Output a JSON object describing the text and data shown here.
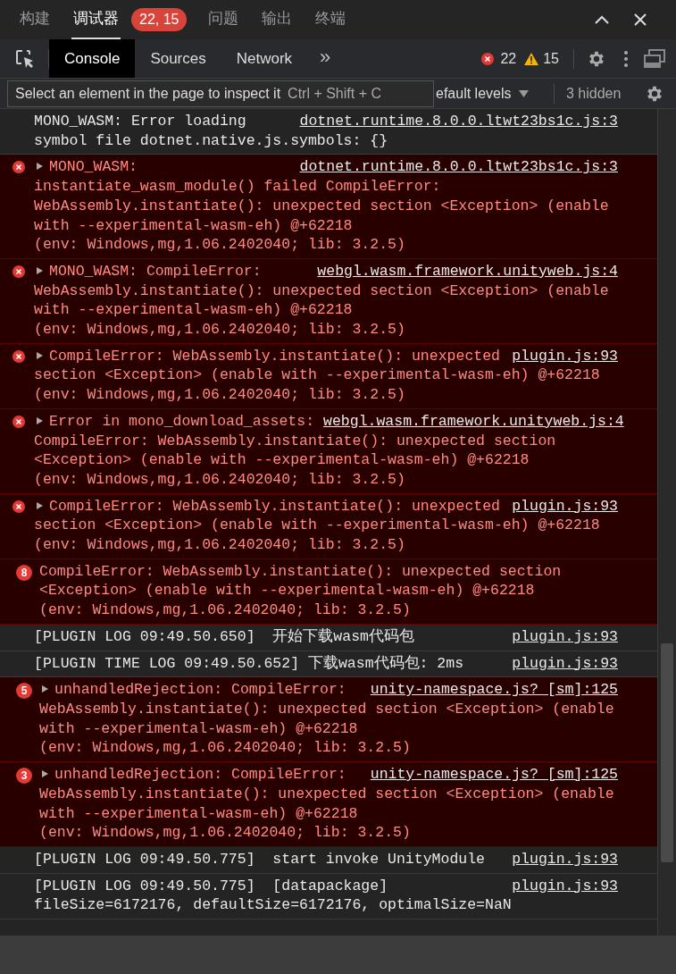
{
  "panel_tabs": [
    {
      "label": "构建",
      "selected": false
    },
    {
      "label": "调试器",
      "selected": true,
      "badge": "22, 15"
    },
    {
      "label": "问题",
      "selected": false
    },
    {
      "label": "输出",
      "selected": false
    },
    {
      "label": "终端",
      "selected": false
    }
  ],
  "devtools_tabs": [
    {
      "label": "Console",
      "selected": true
    },
    {
      "label": "Sources",
      "selected": false
    },
    {
      "label": "Network",
      "selected": false
    }
  ],
  "more_tabs": "»",
  "error_count": "22",
  "warning_count": "15",
  "tooltip": {
    "text": "Select an element in the page to inspect it",
    "shortcut": "Ctrl + Shift + C"
  },
  "filter_bar": {
    "levels": "efault levels",
    "hidden": "3 hidden"
  },
  "entries": [
    {
      "kind": "log",
      "lines": [
        "MONO_WASM: Error loading",
        "symbol file dotnet.native.js.symbols: {}"
      ],
      "source": "dotnet.runtime.8.0.0.ltwt23bs1c.js:3"
    },
    {
      "kind": "error",
      "expandable": true,
      "lines": [
        "MONO_WASM:",
        "instantiate_wasm_module() failed CompileError:",
        "WebAssembly.instantiate(): unexpected section <Exception> (enable",
        "with --experimental-wasm-eh) @+62218",
        "(env: Windows,mg,1.06.2402040; lib: 3.2.5)"
      ],
      "source": "dotnet.runtime.8.0.0.ltwt23bs1c.js:3"
    },
    {
      "kind": "error",
      "expandable": true,
      "lines": [
        "MONO_WASM: CompileError:",
        "WebAssembly.instantiate(): unexpected section <Exception> (enable",
        "with --experimental-wasm-eh) @+62218",
        "(env: Windows,mg,1.06.2402040; lib: 3.2.5)"
      ],
      "source": "webgl.wasm.framework.unityweb.js:4"
    },
    {
      "kind": "error",
      "expandable": true,
      "lines": [
        "CompileError: WebAssembly.instantiate(): unexpected",
        "section <Exception> (enable with --experimental-wasm-eh) @+62218",
        "(env: Windows,mg,1.06.2402040; lib: 3.2.5)"
      ],
      "source": "plugin.js:93"
    },
    {
      "kind": "error",
      "expandable": true,
      "lines": [
        "Error in mono_download_assets:",
        "CompileError: WebAssembly.instantiate(): unexpected section",
        "<Exception> (enable with --experimental-wasm-eh) @+62218",
        "(env: Windows,mg,1.06.2402040; lib: 3.2.5)"
      ],
      "source": "webgl.wasm.framework.unityweb.js:4"
    },
    {
      "kind": "error",
      "expandable": true,
      "lines": [
        "CompileError: WebAssembly.instantiate(): unexpected",
        "section <Exception> (enable with --experimental-wasm-eh) @+62218",
        "(env: Windows,mg,1.06.2402040; lib: 3.2.5)"
      ],
      "source": "plugin.js:93"
    },
    {
      "kind": "error",
      "expandable": false,
      "count": "8",
      "lines": [
        "CompileError: WebAssembly.instantiate(): unexpected section",
        "<Exception> (enable with --experimental-wasm-eh) @+62218",
        "(env: Windows,mg,1.06.2402040; lib: 3.2.5)"
      ]
    },
    {
      "kind": "log",
      "lines": [
        "[PLUGIN LOG 09:49.50.650]  开始下载wasm代码包"
      ],
      "source": "plugin.js:93"
    },
    {
      "kind": "log",
      "lines": [
        "[PLUGIN TIME LOG 09:49.50.652] 下载wasm代码包: 2ms"
      ],
      "source": "plugin.js:93"
    },
    {
      "kind": "error",
      "expandable": true,
      "count": "5",
      "lines": [
        "unhandledRejection: CompileError:",
        "WebAssembly.instantiate(): unexpected section <Exception> (enable",
        "with --experimental-wasm-eh) @+62218",
        "(env: Windows,mg,1.06.2402040; lib: 3.2.5)"
      ],
      "source": "unity-namespace.js? [sm]:125"
    },
    {
      "kind": "error",
      "expandable": true,
      "count": "3",
      "lines": [
        "unhandledRejection: CompileError:",
        "WebAssembly.instantiate(): unexpected section <Exception> (enable",
        "with --experimental-wasm-eh) @+62218",
        "(env: Windows,mg,1.06.2402040; lib: 3.2.5)"
      ],
      "source": "unity-namespace.js? [sm]:125"
    },
    {
      "kind": "log",
      "lines": [
        "[PLUGIN LOG 09:49.50.775]  start invoke UnityModule"
      ],
      "source": "plugin.js:93"
    },
    {
      "kind": "log",
      "lines": [
        "[PLUGIN LOG 09:49.50.775]  [datapackage]",
        "fileSize=6172176, defaultSize=6172176, optimalSize=NaN"
      ],
      "source": "plugin.js:93"
    }
  ]
}
